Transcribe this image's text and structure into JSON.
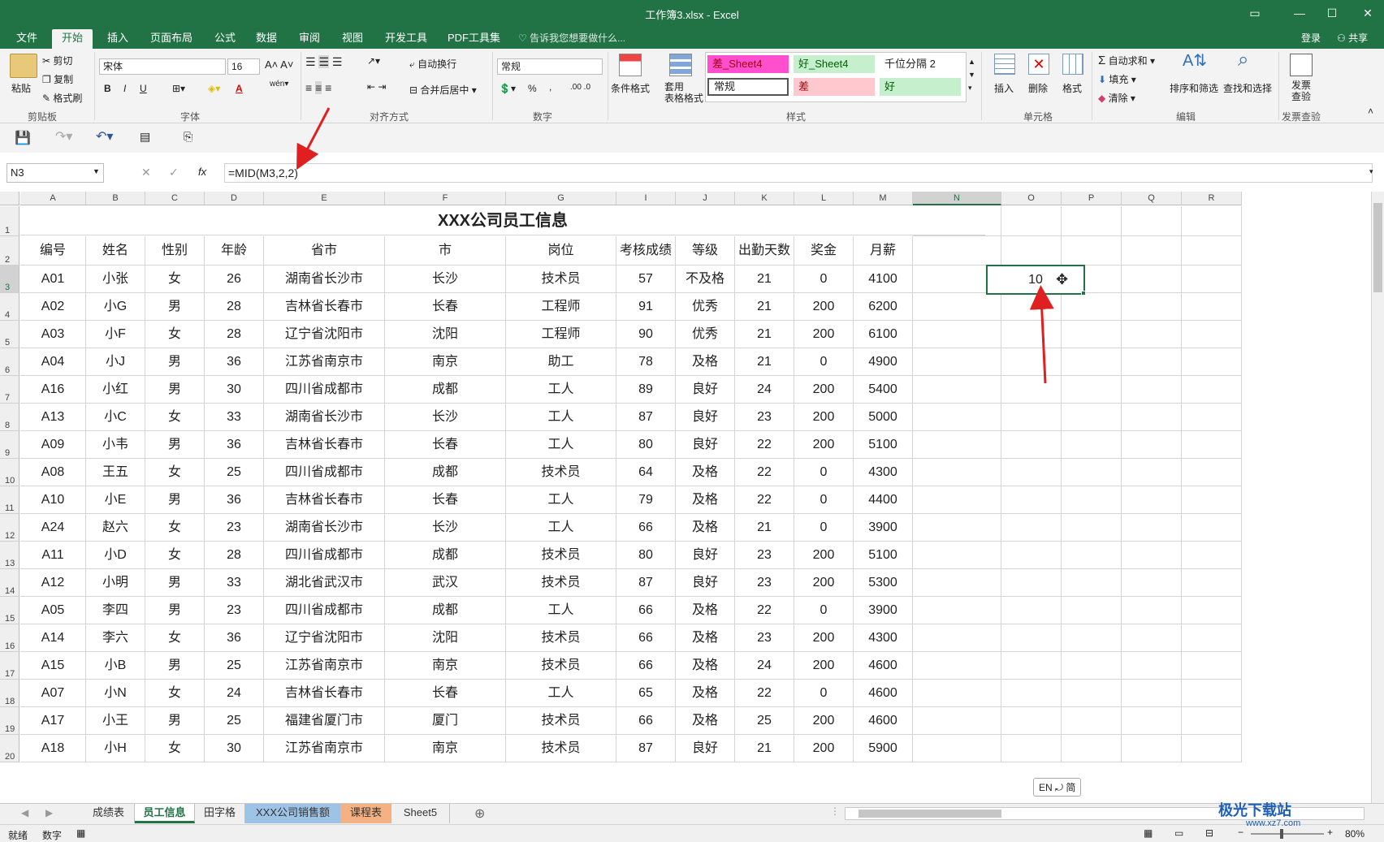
{
  "window": {
    "title": "工作簿3.xlsx - Excel",
    "buttons": [
      "▭",
      "—",
      "☐",
      "✕"
    ]
  },
  "ribbon_tabs": [
    "文件",
    "开始",
    "插入",
    "页面布局",
    "公式",
    "数据",
    "审阅",
    "视图",
    "开发工具",
    "PDF工具集"
  ],
  "active_tab": "开始",
  "tell_me": "告诉我您想要做什么...",
  "account": {
    "login": "登录",
    "share": "共享"
  },
  "clipboard": {
    "paste": "粘贴",
    "cut": "剪切",
    "copy": "复制",
    "format_painter": "格式刷",
    "group": "剪贴板"
  },
  "font": {
    "name": "宋体",
    "size": "16",
    "group": "字体",
    "bold": "B",
    "italic": "I",
    "underline": "U",
    "color_a": "A"
  },
  "alignment": {
    "wrap": "自动换行",
    "merge": "合并后居中",
    "group": "对齐方式"
  },
  "number": {
    "format": "常规",
    "percent": "%",
    "comma": ",",
    "group": "数字"
  },
  "styles": {
    "conditional": "条件格式",
    "table_format": "套用\n表格格式",
    "cells": [
      "差_Sheet4",
      "好_Sheet4",
      "千位分隔 2",
      "常规",
      "差",
      "好"
    ],
    "group": "样式"
  },
  "cells_group": {
    "insert": "插入",
    "delete": "删除",
    "format": "格式",
    "group": "单元格"
  },
  "editing": {
    "autosum": "自动求和",
    "fill": "填充",
    "clear": "清除",
    "sort": "排序和筛选",
    "find": "查找和选择",
    "group": "编辑"
  },
  "invoice": {
    "label": "发票\n查验",
    "group": "发票查验"
  },
  "formula_bar": {
    "name_box": "N3",
    "fx": "fx",
    "formula": "=MID(M3,2,2)"
  },
  "columns": [
    "A",
    "B",
    "C",
    "D",
    "E",
    "F",
    "G",
    "I",
    "J",
    "K",
    "L",
    "M",
    "N",
    "O",
    "P",
    "Q",
    "R"
  ],
  "sheet": {
    "title": "XXX公司员工信息",
    "headers": [
      "编号",
      "姓名",
      "性别",
      "年龄",
      "省市",
      "市",
      "岗位",
      "考核成绩",
      "等级",
      "出勤天数",
      "奖金",
      "月薪"
    ],
    "rows": [
      [
        "A01",
        "小张",
        "女",
        "26",
        "湖南省长沙市",
        "长沙",
        "技术员",
        "57",
        "不及格",
        "21",
        "0",
        "4100"
      ],
      [
        "A02",
        "小G",
        "男",
        "28",
        "吉林省长春市",
        "长春",
        "工程师",
        "91",
        "优秀",
        "21",
        "200",
        "6200"
      ],
      [
        "A03",
        "小F",
        "女",
        "28",
        "辽宁省沈阳市",
        "沈阳",
        "工程师",
        "90",
        "优秀",
        "21",
        "200",
        "6100"
      ],
      [
        "A04",
        "小J",
        "男",
        "36",
        "江苏省南京市",
        "南京",
        "助工",
        "78",
        "及格",
        "21",
        "0",
        "4900"
      ],
      [
        "A16",
        "小红",
        "男",
        "30",
        "四川省成都市",
        "成都",
        "工人",
        "89",
        "良好",
        "24",
        "200",
        "5400"
      ],
      [
        "A13",
        "小C",
        "女",
        "33",
        "湖南省长沙市",
        "长沙",
        "工人",
        "87",
        "良好",
        "23",
        "200",
        "5000"
      ],
      [
        "A09",
        "小韦",
        "男",
        "36",
        "吉林省长春市",
        "长春",
        "工人",
        "80",
        "良好",
        "22",
        "200",
        "5100"
      ],
      [
        "A08",
        "王五",
        "女",
        "25",
        "四川省成都市",
        "成都",
        "技术员",
        "64",
        "及格",
        "22",
        "0",
        "4300"
      ],
      [
        "A10",
        "小E",
        "男",
        "36",
        "吉林省长春市",
        "长春",
        "工人",
        "79",
        "及格",
        "22",
        "0",
        "4400"
      ],
      [
        "A24",
        "赵六",
        "女",
        "23",
        "湖南省长沙市",
        "长沙",
        "工人",
        "66",
        "及格",
        "21",
        "0",
        "3900"
      ],
      [
        "A11",
        "小D",
        "女",
        "28",
        "四川省成都市",
        "成都",
        "技术员",
        "80",
        "良好",
        "23",
        "200",
        "5100"
      ],
      [
        "A12",
        "小明",
        "男",
        "33",
        "湖北省武汉市",
        "武汉",
        "技术员",
        "87",
        "良好",
        "23",
        "200",
        "5300"
      ],
      [
        "A05",
        "李四",
        "男",
        "23",
        "四川省成都市",
        "成都",
        "工人",
        "66",
        "及格",
        "22",
        "0",
        "3900"
      ],
      [
        "A14",
        "李六",
        "女",
        "36",
        "辽宁省沈阳市",
        "沈阳",
        "技术员",
        "66",
        "及格",
        "23",
        "200",
        "4300"
      ],
      [
        "A15",
        "小B",
        "男",
        "25",
        "江苏省南京市",
        "南京",
        "技术员",
        "66",
        "及格",
        "24",
        "200",
        "4600"
      ],
      [
        "A07",
        "小N",
        "女",
        "24",
        "吉林省长春市",
        "长春",
        "工人",
        "65",
        "及格",
        "22",
        "0",
        "4600"
      ],
      [
        "A17",
        "小王",
        "男",
        "25",
        "福建省厦门市",
        "厦门",
        "技术员",
        "66",
        "及格",
        "25",
        "200",
        "4600"
      ],
      [
        "A18",
        "小H",
        "女",
        "30",
        "江苏省南京市",
        "南京",
        "技术员",
        "87",
        "良好",
        "21",
        "200",
        "5900"
      ]
    ],
    "n3_value": "10",
    "ime": "EN ⤾ 简"
  },
  "sheet_tabs": [
    "成绩表",
    "员工信息",
    "田字格",
    "XXX公司销售额",
    "课程表",
    "Sheet5"
  ],
  "active_sheet": "员工信息",
  "status": {
    "ready": "就绪",
    "num": "数字",
    "zoom": "80%"
  },
  "watermark": {
    "brand": "极光下载站",
    "url": "www.xz7.com"
  },
  "colors": {
    "excel_green": "#217346",
    "arrow_red": "#e02020"
  }
}
